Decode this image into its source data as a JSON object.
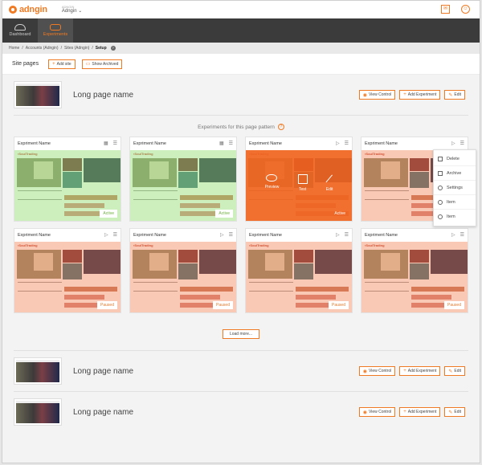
{
  "app": {
    "logo": "adngin",
    "account_label": "ADNGIN",
    "account_name": "Adngin ⌄"
  },
  "topbar": {
    "chat_icon": "chat-icon",
    "user_icon": "user-icon"
  },
  "nav": [
    {
      "label": "Dashboard",
      "icon": "cloud-icon",
      "active": false
    },
    {
      "label": "Experiments",
      "icon": "experiments-icon",
      "active": true
    }
  ],
  "breadcrumb": {
    "home": "Home",
    "accounts": "Accounts (Adngin)",
    "sites": "Sites (Adngin)",
    "current": "Setup",
    "sep": "/"
  },
  "site_pages": {
    "title": "Site pages",
    "add_site": "Add site",
    "show_archived": "Show Archived"
  },
  "page_buttons": {
    "view_control": "View Control",
    "add_experiment": "Add Experiment",
    "edit": "Edit"
  },
  "pages": [
    {
      "name": "Long page name"
    },
    {
      "name": "Long page name"
    },
    {
      "name": "Long page name"
    }
  ],
  "experiments_heading": "Experiments for this page pattern",
  "thumb_logo": "▪SoulTrading",
  "cards": [
    {
      "name": "Expriment Name",
      "status": "Active"
    },
    {
      "name": "Expriment Name",
      "status": "Active"
    },
    {
      "name": "Expriment Name",
      "status": "Active"
    },
    {
      "name": "Expriment Name",
      "status": ""
    },
    {
      "name": "Expriment Name",
      "status": "Paused"
    },
    {
      "name": "Expriment Name",
      "status": "Paused"
    },
    {
      "name": "Expriment Name",
      "status": "Paused"
    },
    {
      "name": "Expriment Name",
      "status": "Paused"
    }
  ],
  "hover_actions": {
    "preview": "Preview",
    "test": "Test",
    "edit": "Edit"
  },
  "context_menu": [
    "Delete",
    "Archive",
    "Settings",
    "Item",
    "Item"
  ],
  "load_more": "Load more...",
  "colors": {
    "accent": "#f07a23",
    "nav_bg": "#3b3b3b",
    "active_tint": "#91dc6e",
    "paused_tint": "#f07846"
  }
}
